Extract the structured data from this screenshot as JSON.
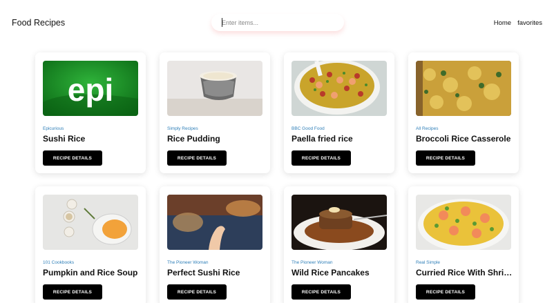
{
  "header": {
    "brand": "Food Recipes",
    "search_placeholder": "Enter items...",
    "nav": [
      "Home",
      "favorites"
    ]
  },
  "button_label": "RECIPE DETAILS",
  "recipes": [
    {
      "source": "Epicurious",
      "title": "Sushi Rice",
      "image": "epi-logo"
    },
    {
      "source": "Simply Recipes",
      "title": "Rice Pudding",
      "image": "rice-pudding-bowl"
    },
    {
      "source": "BBC Good Food",
      "title": "Paella fried rice",
      "image": "paella-bowl"
    },
    {
      "source": "All Recipes",
      "title": "Broccoli Rice Casserole",
      "image": "casserole"
    },
    {
      "source": "101 Cookbooks",
      "title": "Pumpkin and Rice Soup",
      "image": "pumpkin-soup"
    },
    {
      "source": "The Pioneer Woman",
      "title": "Perfect Sushi Rice",
      "image": "sushi-hand"
    },
    {
      "source": "The Pioneer Woman",
      "title": "Wild Rice Pancakes",
      "image": "pancakes"
    },
    {
      "source": "Real Simple",
      "title": "Curried Rice With Shrimp",
      "image": "curried-shrimp"
    }
  ],
  "colors": {
    "accent_source": "#2f7fb8",
    "button_bg": "#000000",
    "button_text": "#ffffff",
    "search_glow": "#f07878"
  }
}
